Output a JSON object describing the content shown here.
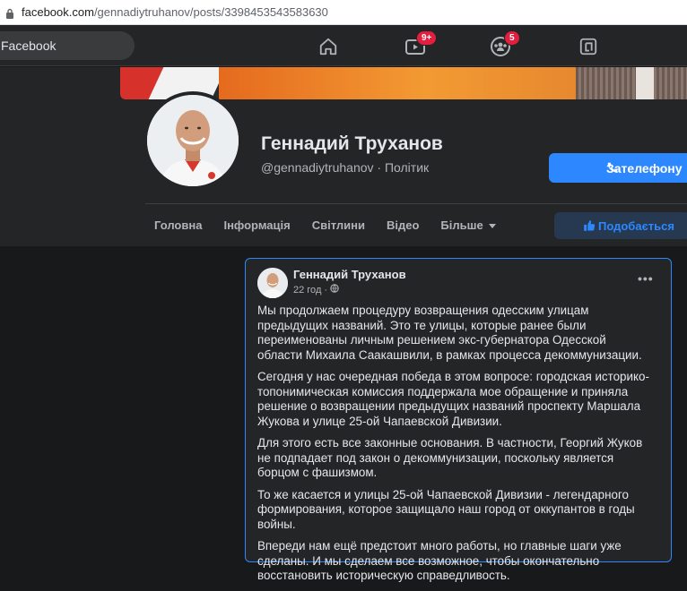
{
  "browser": {
    "url_domain": "facebook.com",
    "url_path": "/gennadiytruhanov/posts/3398453543583630"
  },
  "topnav": {
    "search_placeholder": "Facebook",
    "video_badge": "9+",
    "groups_badge": "5"
  },
  "profile": {
    "name": "Геннадий Труханов",
    "handle_line": "@gennadiytruhanov · Політик",
    "call_button": "Зателефону",
    "like_button": "Подобається",
    "tabs": [
      "Головна",
      "Інформація",
      "Світлини",
      "Відео",
      "Більше"
    ]
  },
  "post": {
    "author": "Геннадий Труханов",
    "time": "22 год ·",
    "paragraphs": [
      "Мы продолжаем процедуру возвращения одесским улицам предыдущих названий. Это те улицы, которые ранее были переименованы личным решением экс-губернатора Одесской области Михаила Саакашвили, в рамках процесса декоммунизации.",
      "Сегодня у нас очередная победа в этом вопросе: городская историко-топонимическая комиссия поддержала мое обращение и приняла решение о возвращении предыдущих названий проспекту Маршала Жукова и улице 25-ой Чапаевской Дивизии.",
      "Для этого есть все законные основания. В частности, Георгий Жуков не подпадает под закон о декоммунизации, поскольку является борцом с фашизмом.",
      "То же касается и улицы 25-ой Чапаевской Дивизии - легендарного формирования, которое защищало наш город от оккупантов в годы войны.",
      "Впереди нам ещё предстоит много работы, но главные шаги уже сделаны. И мы сделаем все возможное, чтобы окончательно восстановить историческую справедливость."
    ]
  },
  "colors": {
    "accent": "#2d88ff",
    "badge": "#e41e3f",
    "surface": "#242526",
    "background": "#18191a"
  }
}
